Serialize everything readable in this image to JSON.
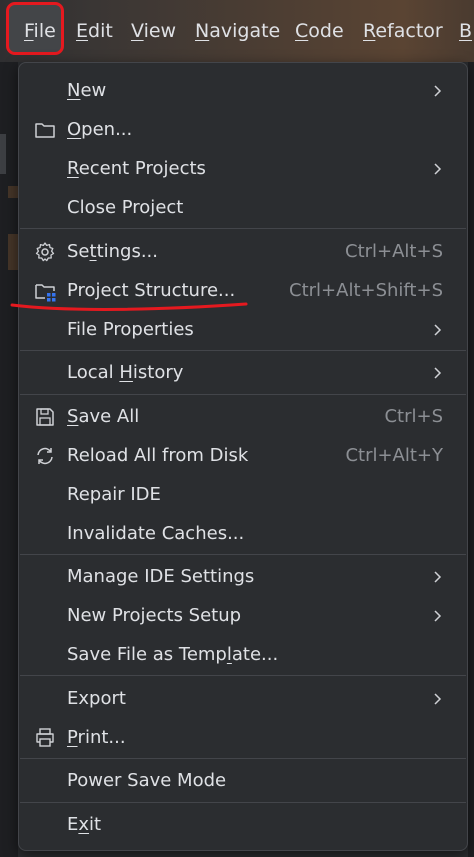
{
  "menubar": {
    "items": [
      {
        "pre": "",
        "u": "F",
        "post": "ile"
      },
      {
        "pre": "",
        "u": "E",
        "post": "dit"
      },
      {
        "pre": "",
        "u": "V",
        "post": "iew"
      },
      {
        "pre": "",
        "u": "N",
        "post": "avigate"
      },
      {
        "pre": "",
        "u": "C",
        "post": "ode"
      },
      {
        "pre": "",
        "u": "R",
        "post": "efactor"
      },
      {
        "pre": "",
        "u": "B",
        "post": ""
      }
    ]
  },
  "file_menu": {
    "new": {
      "u": "N",
      "post": "ew"
    },
    "open": {
      "u": "O",
      "post": "pen..."
    },
    "recent": {
      "u": "R",
      "post": "ecent Projects"
    },
    "close_project": "Close Project",
    "settings": {
      "pre": "Se",
      "u": "t",
      "post": "tings...",
      "shortcut": "Ctrl+Alt+S"
    },
    "project_structure": {
      "label": "Project Structure...",
      "shortcut": "Ctrl+Alt+Shift+S"
    },
    "file_properties": "File Properties",
    "local_history": {
      "pre": "Local ",
      "u": "H",
      "post": "istory"
    },
    "save_all": {
      "u": "S",
      "post": "ave All",
      "shortcut": "Ctrl+S"
    },
    "reload": {
      "label": "Reload All from Disk",
      "shortcut": "Ctrl+Alt+Y"
    },
    "repair_ide": "Repair IDE",
    "invalidate": "Invalidate Caches...",
    "manage_ide": "Manage IDE Settings",
    "new_projects_setup": "New Projects Setup",
    "save_template": {
      "pre": "Save File as Temp",
      "u": "l",
      "post": "ate..."
    },
    "export": "Export",
    "print": {
      "u": "P",
      "post": "rint..."
    },
    "power_save": "Power Save Mode",
    "exit": {
      "pre": "E",
      "u": "x",
      "post": "it"
    }
  },
  "colors": {
    "menu_bg": "#2b2d30",
    "text": "#dfe1e5",
    "shortcut": "#8c8f94",
    "annotation": "#e5191f",
    "accent_blue": "#3574f0"
  }
}
